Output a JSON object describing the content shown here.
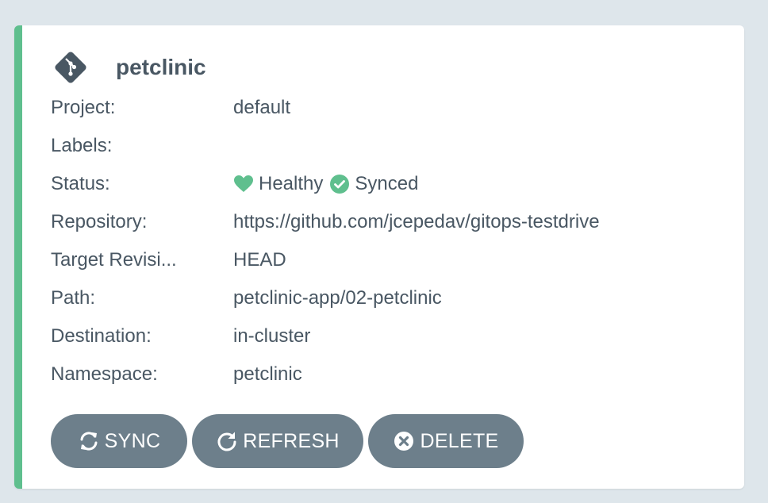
{
  "app": {
    "name": "petclinic",
    "icon": "git-icon",
    "accent_color": "#5fbf8e"
  },
  "fields": [
    {
      "label": "Project:",
      "value": "default"
    },
    {
      "label": "Labels:",
      "value": ""
    },
    {
      "label": "Status:",
      "health": "Healthy",
      "sync": "Synced",
      "health_color": "#5fbf8e",
      "sync_color": "#5fbf8e"
    },
    {
      "label": "Repository:",
      "value": "https://github.com/jcepedav/gitops-testdrive"
    },
    {
      "label": "Target Revisi...",
      "value": "HEAD"
    },
    {
      "label": "Path:",
      "value": "petclinic-app/02-petclinic"
    },
    {
      "label": "Destination:",
      "value": "in-cluster"
    },
    {
      "label": "Namespace:",
      "value": "petclinic"
    }
  ],
  "actions": {
    "sync_label": "SYNC",
    "refresh_label": "REFRESH",
    "delete_label": "DELETE",
    "button_color": "#6d7f8b"
  }
}
